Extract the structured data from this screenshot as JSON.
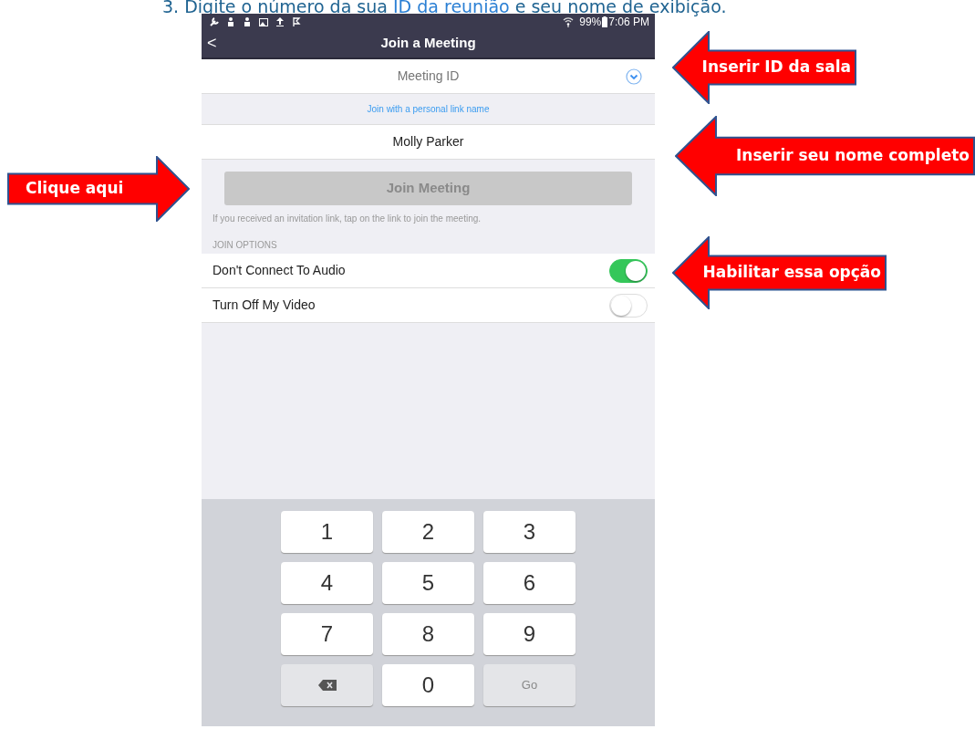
{
  "caption": {
    "before": "3. Digite o número da sua ",
    "link": "ID da reunião",
    "after": " e seu nome de exibição."
  },
  "status_bar": {
    "battery": "99%",
    "time": "7:06 PM"
  },
  "header": {
    "back": "<",
    "title": "Join a Meeting"
  },
  "meeting_id": {
    "placeholder": "Meeting ID"
  },
  "personal_link": "Join with a personal link name",
  "name_field": {
    "value": "Molly Parker"
  },
  "join_button": {
    "label": "Join Meeting",
    "disabled": true
  },
  "hint": "If you received an invitation link, tap on the link to join the meeting.",
  "options_heading": "JOIN OPTIONS",
  "options": [
    {
      "label": "Don't Connect To Audio",
      "on": true
    },
    {
      "label": "Turn Off My Video",
      "on": false
    }
  ],
  "keypad": [
    {
      "kind": "digit",
      "label": "1"
    },
    {
      "kind": "digit",
      "label": "2"
    },
    {
      "kind": "digit",
      "label": "3"
    },
    {
      "kind": "digit",
      "label": "4"
    },
    {
      "kind": "digit",
      "label": "5"
    },
    {
      "kind": "digit",
      "label": "6"
    },
    {
      "kind": "digit",
      "label": "7"
    },
    {
      "kind": "digit",
      "label": "8"
    },
    {
      "kind": "digit",
      "label": "9"
    },
    {
      "kind": "backspace"
    },
    {
      "kind": "digit",
      "label": "0"
    },
    {
      "kind": "go",
      "label": "Go"
    }
  ],
  "callouts": [
    {
      "text": "Inserir ID da sala",
      "kind": "left"
    },
    {
      "text": "Inserir seu nome completo",
      "kind": "left"
    },
    {
      "text": "Habilitar essa opção",
      "kind": "left"
    },
    {
      "text": "Clique aqui",
      "kind": "right"
    }
  ]
}
